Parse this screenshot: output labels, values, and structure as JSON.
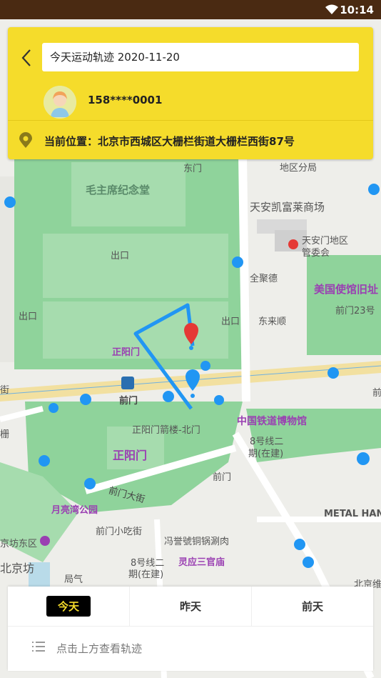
{
  "status_bar": {
    "time": "10:14"
  },
  "header": {
    "title": "今天运动轨迹  2020-11-20",
    "phone": "158****0001",
    "location": "当前位置：北京市西城区大栅栏街道大栅栏西街87号"
  },
  "map": {
    "labels": {
      "mao_memorial": "毛主席纪念堂",
      "tiananmen_kerry": "天安凯富莱商场",
      "district_branch": "地区分局",
      "dongmen": "东门",
      "exit_a": "出口",
      "exit_b": "出口",
      "exit_c": "出口",
      "quanjude": "全聚德",
      "tiananmen_district": "天安门地区",
      "management": "管委会",
      "us_embassy": "美国使馆旧址",
      "qianmen23": "前门23号",
      "donglaishun": "东来顺",
      "zhengyangmen_top": "正阳门",
      "qianmen": "前门",
      "zhengyangmen_arrow": "正阳门箭楼-北门",
      "zhengyangmen_big": "正阳门",
      "railway_museum": "中国铁道博物馆",
      "line8_a": "8号线二",
      "line8_b": "期(在建)",
      "qianmen_road": "前门",
      "qianmen_st": "前门大街",
      "moon_park": "月亮湾公园",
      "qianmen_snack": "前门小吃街",
      "fengyi": "冯誉號铜锅涮肉",
      "line8_c": "8号线二",
      "line8_d": "期(在建)",
      "lingying": "灵应三官庙",
      "jingfang": "京坊东区",
      "beijingfang": "北京坊",
      "juqi": "局气",
      "metal_hand": "METAL HAND",
      "beijing_right": "北京维",
      "border_jie": "街",
      "border_qian": "前",
      "border_xian": "栅"
    }
  },
  "tabs": [
    {
      "label": "今天",
      "active": true
    },
    {
      "label": "昨天",
      "active": false
    },
    {
      "label": "前天",
      "active": false
    }
  ],
  "hint": "点击上方查看轨迹",
  "colors": {
    "accent": "#f5dc2b",
    "track": "#2196f3",
    "marker_red": "#e53935",
    "status_bar": "#4a2a12"
  }
}
